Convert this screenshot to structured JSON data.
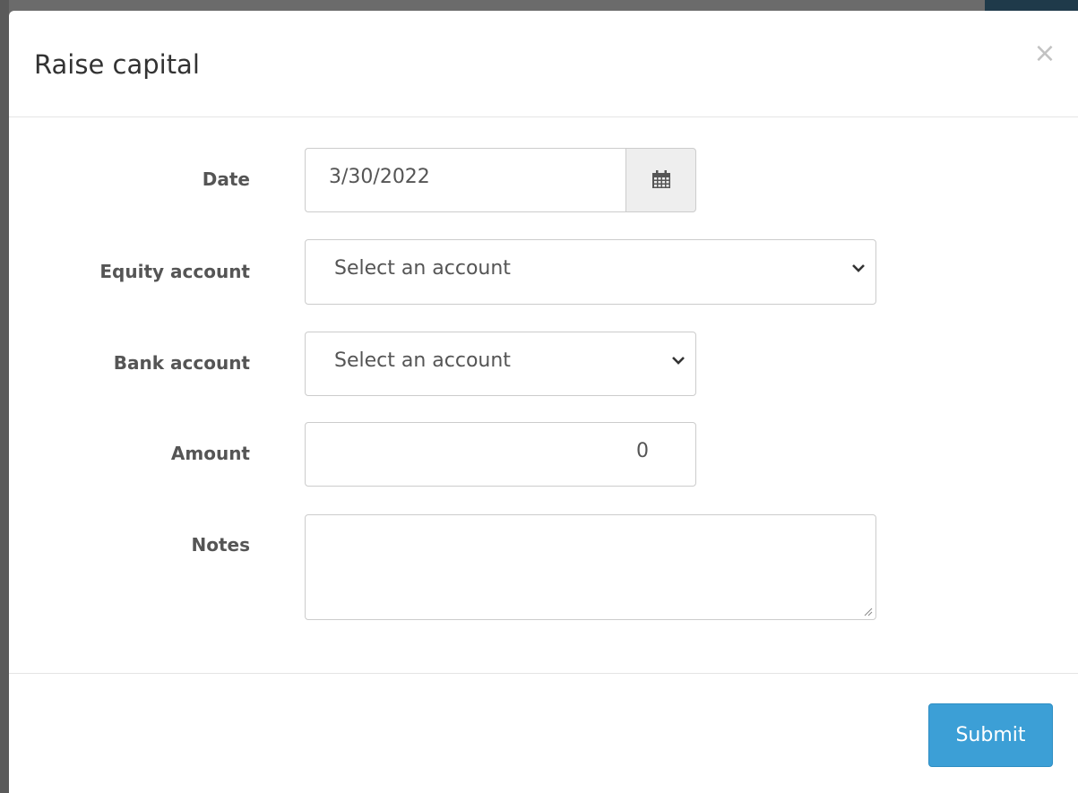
{
  "modal": {
    "title": "Raise capital",
    "close_label": "×"
  },
  "form": {
    "date": {
      "label": "Date",
      "value": "3/30/2022",
      "icon": "calendar-icon"
    },
    "equity_account": {
      "label": "Equity account",
      "selected": "Select an account"
    },
    "bank_account": {
      "label": "Bank account",
      "selected": "Select an account"
    },
    "amount": {
      "label": "Amount",
      "value": "0"
    },
    "notes": {
      "label": "Notes",
      "value": ""
    }
  },
  "footer": {
    "submit_label": "Submit"
  },
  "colors": {
    "primary": "#3c9fd6",
    "label": "#555555",
    "border": "#cccccc",
    "addon_bg": "#eeeeee"
  }
}
